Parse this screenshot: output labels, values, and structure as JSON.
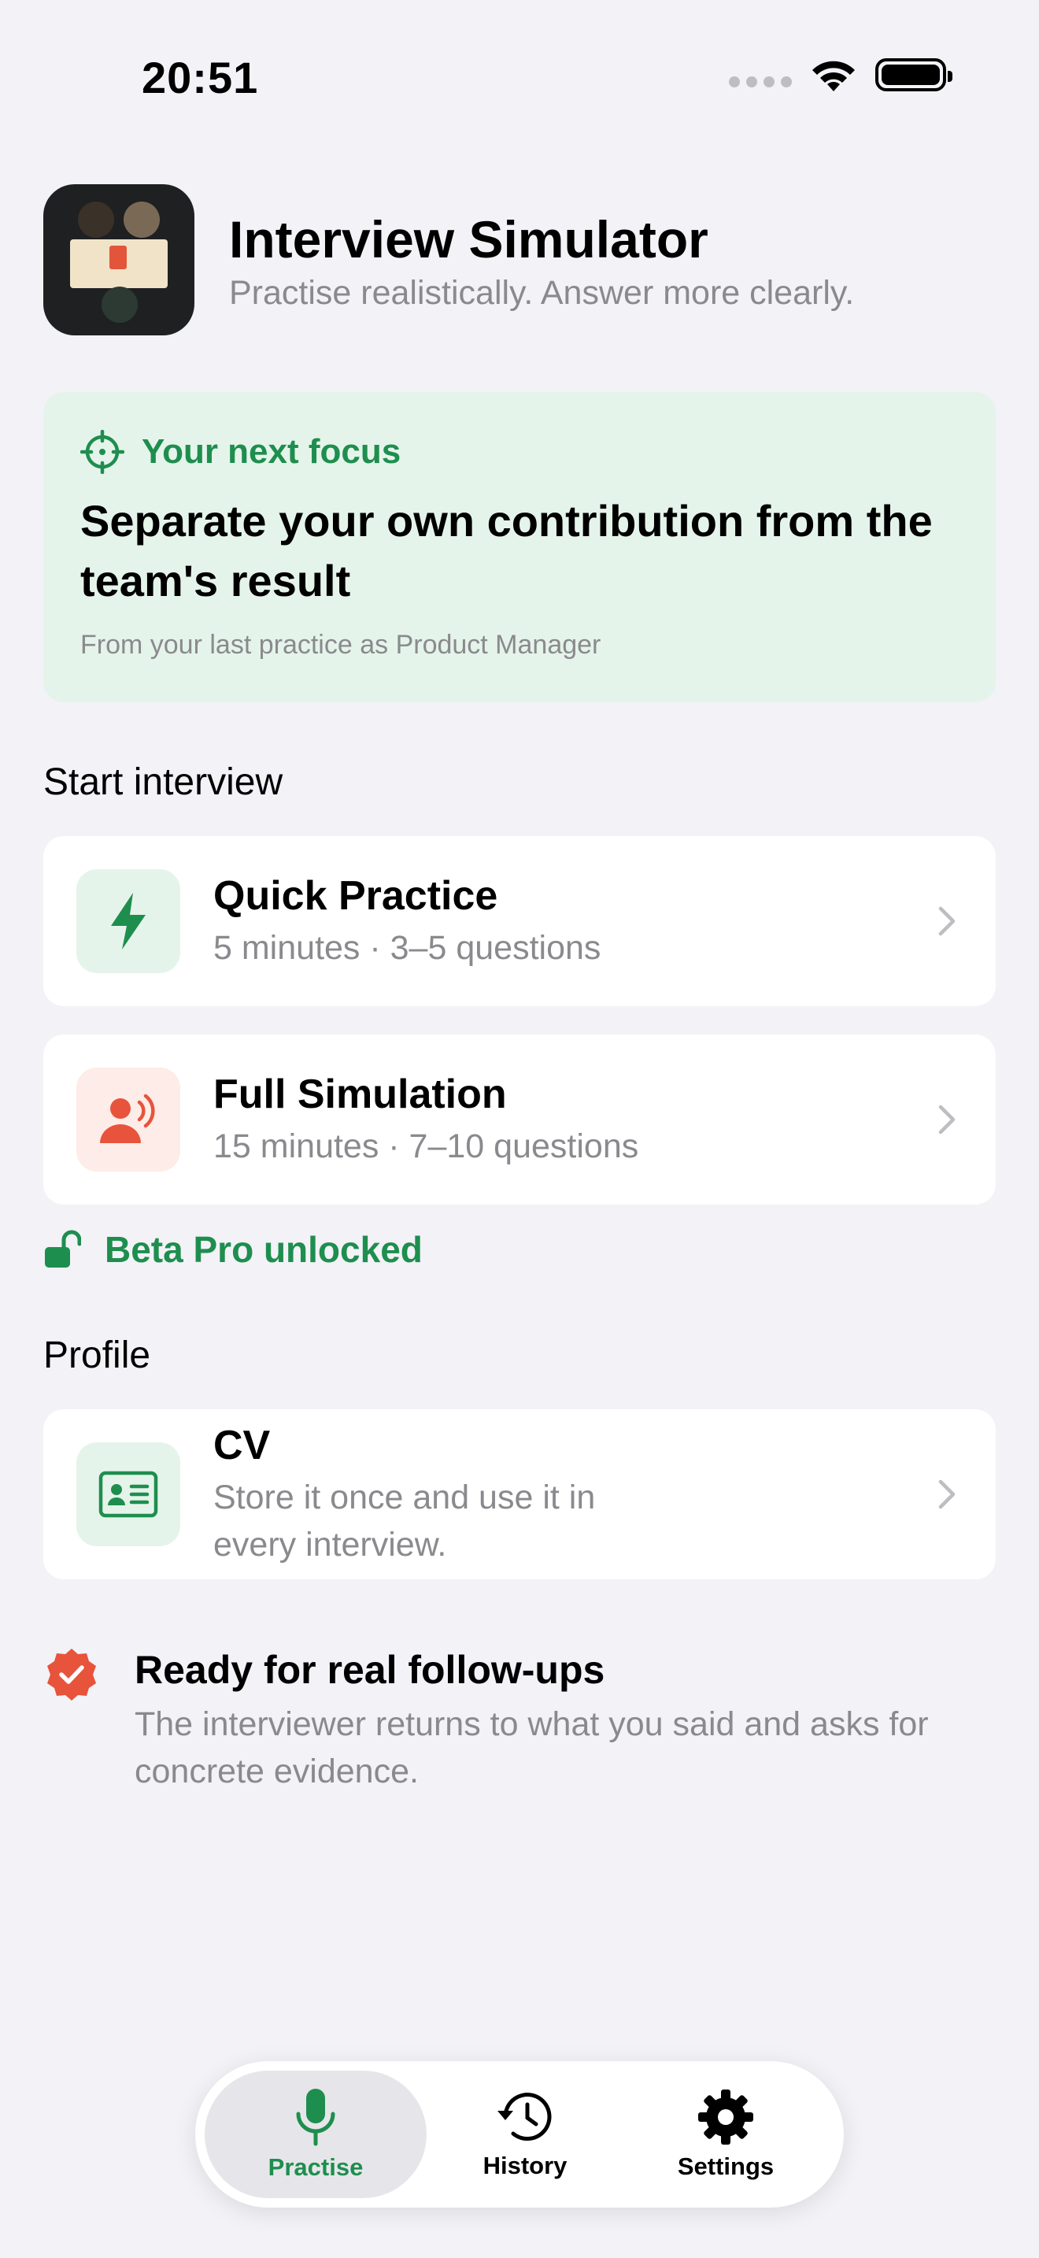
{
  "status_bar": {
    "time": "20:51"
  },
  "header": {
    "title": "Interview Simulator",
    "subtitle": "Practise realistically. Answer more clearly."
  },
  "focus": {
    "label": "Your next focus",
    "title": "Separate your own contribution from the team's result",
    "note": "From your last practice as Product Manager"
  },
  "start_section": {
    "title": "Start interview"
  },
  "modes": [
    {
      "title": "Quick Practice",
      "subtitle": "5 minutes · 3–5 questions",
      "icon": "bolt-icon"
    },
    {
      "title": "Full Simulation",
      "subtitle": "15 minutes · 7–10 questions",
      "icon": "speaking-person-icon"
    }
  ],
  "beta": {
    "label": "Beta Pro unlocked",
    "icon": "unlocked-padlock-icon"
  },
  "profile_section": {
    "title": "Profile"
  },
  "cv": {
    "title": "CV",
    "subtitle": "Store it once and use it in every interview.",
    "icon": "id-card-icon"
  },
  "followups": {
    "title": "Ready for real follow-ups",
    "subtitle": "The interviewer returns to what you said and asks for concrete evidence.",
    "icon": "verified-badge-icon"
  },
  "tabs": [
    {
      "label": "Practise",
      "icon": "microphone-icon",
      "active": true
    },
    {
      "label": "History",
      "icon": "history-clock-icon",
      "active": false
    },
    {
      "label": "Settings",
      "icon": "gear-icon",
      "active": false
    }
  ],
  "colors": {
    "accent_green": "#1E8E4E",
    "accent_red": "#E8533B",
    "background": "#F2F2F7",
    "focus_card": "#E5F4EA",
    "secondary_text": "#8A8A8E"
  }
}
